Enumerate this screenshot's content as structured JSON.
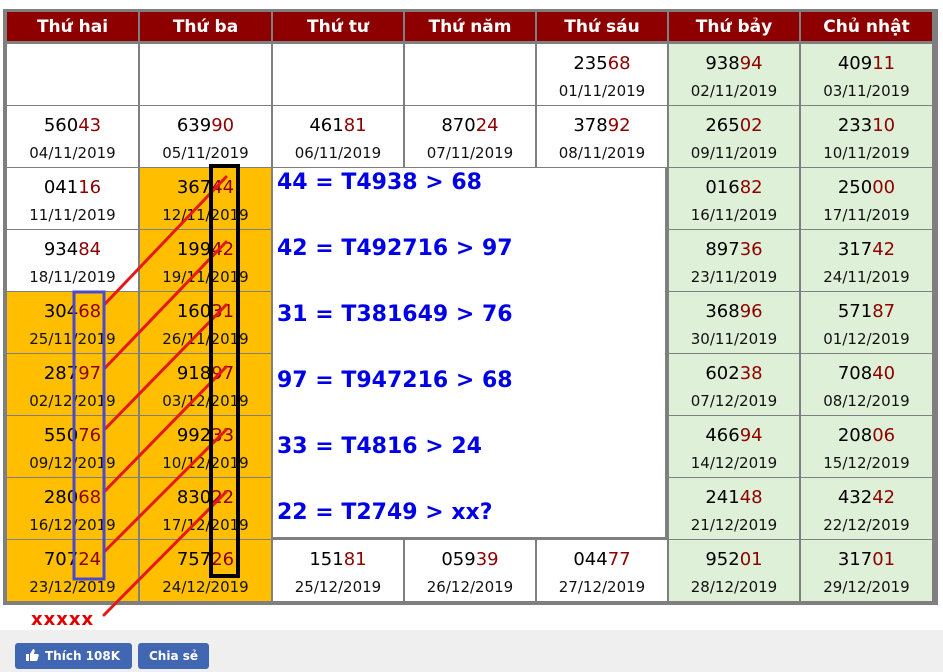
{
  "calendar": {
    "headers": [
      "Thứ hai",
      "Thứ ba",
      "Thứ tư",
      "Thứ năm",
      "Thứ sáu",
      "Thứ bảy",
      "Chủ nhật"
    ],
    "rows": [
      [
        null,
        null,
        null,
        null,
        {
          "head": "235",
          "tail": "68",
          "date": "01/11/2019"
        },
        {
          "head": "938",
          "tail": "94",
          "date": "02/11/2019"
        },
        {
          "head": "409",
          "tail": "11",
          "date": "03/11/2019"
        }
      ],
      [
        {
          "head": "560",
          "tail": "43",
          "date": "04/11/2019"
        },
        {
          "head": "639",
          "tail": "90",
          "date": "05/11/2019"
        },
        {
          "head": "461",
          "tail": "81",
          "date": "06/11/2019"
        },
        {
          "head": "870",
          "tail": "24",
          "date": "07/11/2019"
        },
        {
          "head": "378",
          "tail": "92",
          "date": "08/11/2019"
        },
        {
          "head": "265",
          "tail": "02",
          "date": "09/11/2019"
        },
        {
          "head": "233",
          "tail": "10",
          "date": "10/11/2019"
        }
      ],
      [
        {
          "head": "041",
          "tail": "16",
          "date": "11/11/2019"
        },
        {
          "head": "367",
          "tail": "44",
          "date": "12/11/2019"
        },
        null,
        null,
        null,
        {
          "head": "016",
          "tail": "82",
          "date": "16/11/2019"
        },
        {
          "head": "250",
          "tail": "00",
          "date": "17/11/2019"
        }
      ],
      [
        {
          "head": "934",
          "tail": "84",
          "date": "18/11/2019"
        },
        {
          "head": "199",
          "tail": "42",
          "date": "19/11/2019"
        },
        null,
        null,
        null,
        {
          "head": "897",
          "tail": "36",
          "date": "23/11/2019"
        },
        {
          "head": "317",
          "tail": "42",
          "date": "24/11/2019"
        }
      ],
      [
        {
          "head": "304",
          "tail": "68",
          "date": "25/11/2019"
        },
        {
          "head": "160",
          "tail": "31",
          "date": "26/11/2019"
        },
        null,
        null,
        null,
        {
          "head": "368",
          "tail": "96",
          "date": "30/11/2019"
        },
        {
          "head": "571",
          "tail": "87",
          "date": "01/12/2019"
        }
      ],
      [
        {
          "head": "287",
          "tail": "97",
          "date": "02/12/2019"
        },
        {
          "head": "918",
          "tail": "97",
          "date": "03/12/2019"
        },
        null,
        null,
        null,
        {
          "head": "602",
          "tail": "38",
          "date": "07/12/2019"
        },
        {
          "head": "708",
          "tail": "40",
          "date": "08/12/2019"
        }
      ],
      [
        {
          "head": "550",
          "tail": "76",
          "date": "09/12/2019"
        },
        {
          "head": "992",
          "tail": "33",
          "date": "10/12/2019"
        },
        null,
        null,
        null,
        {
          "head": "466",
          "tail": "94",
          "date": "14/12/2019"
        },
        {
          "head": "208",
          "tail": "06",
          "date": "15/12/2019"
        }
      ],
      [
        {
          "head": "280",
          "tail": "68",
          "date": "16/12/2019"
        },
        {
          "head": "830",
          "tail": "22",
          "date": "17/12/2019"
        },
        null,
        null,
        null,
        {
          "head": "241",
          "tail": "48",
          "date": "21/12/2019"
        },
        {
          "head": "432",
          "tail": "42",
          "date": "22/12/2019"
        }
      ],
      [
        {
          "head": "707",
          "tail": "24",
          "date": "23/12/2019"
        },
        {
          "head": "757",
          "tail": "26",
          "date": "24/12/2019"
        },
        {
          "head": "151",
          "tail": "81",
          "date": "25/12/2019"
        },
        {
          "head": "059",
          "tail": "39",
          "date": "26/12/2019"
        },
        {
          "head": "044",
          "tail": "77",
          "date": "27/12/2019"
        },
        {
          "head": "952",
          "tail": "01",
          "date": "28/12/2019"
        },
        {
          "head": "317",
          "tail": "01",
          "date": "29/12/2019"
        }
      ]
    ]
  },
  "formulas": [
    "44 = T4938 > 68",
    "42 = T492716 > 97",
    "31 = T381649 > 76",
    "97 = T947216 > 68",
    "33 = T4816 > 24",
    "22 = T2749 > xx?"
  ],
  "marker": "xxxxx",
  "social": {
    "like_label": "Thích 108K",
    "share_label": "Chia sẻ"
  },
  "colors": {
    "header": "#8e0000",
    "weekend": "#dff0d8",
    "highlight": "#ffbf00",
    "formula": "#0000e6",
    "arrow": "#e61919",
    "column_box_blue": "#4a4ad0",
    "column_box_black": "#000000"
  }
}
